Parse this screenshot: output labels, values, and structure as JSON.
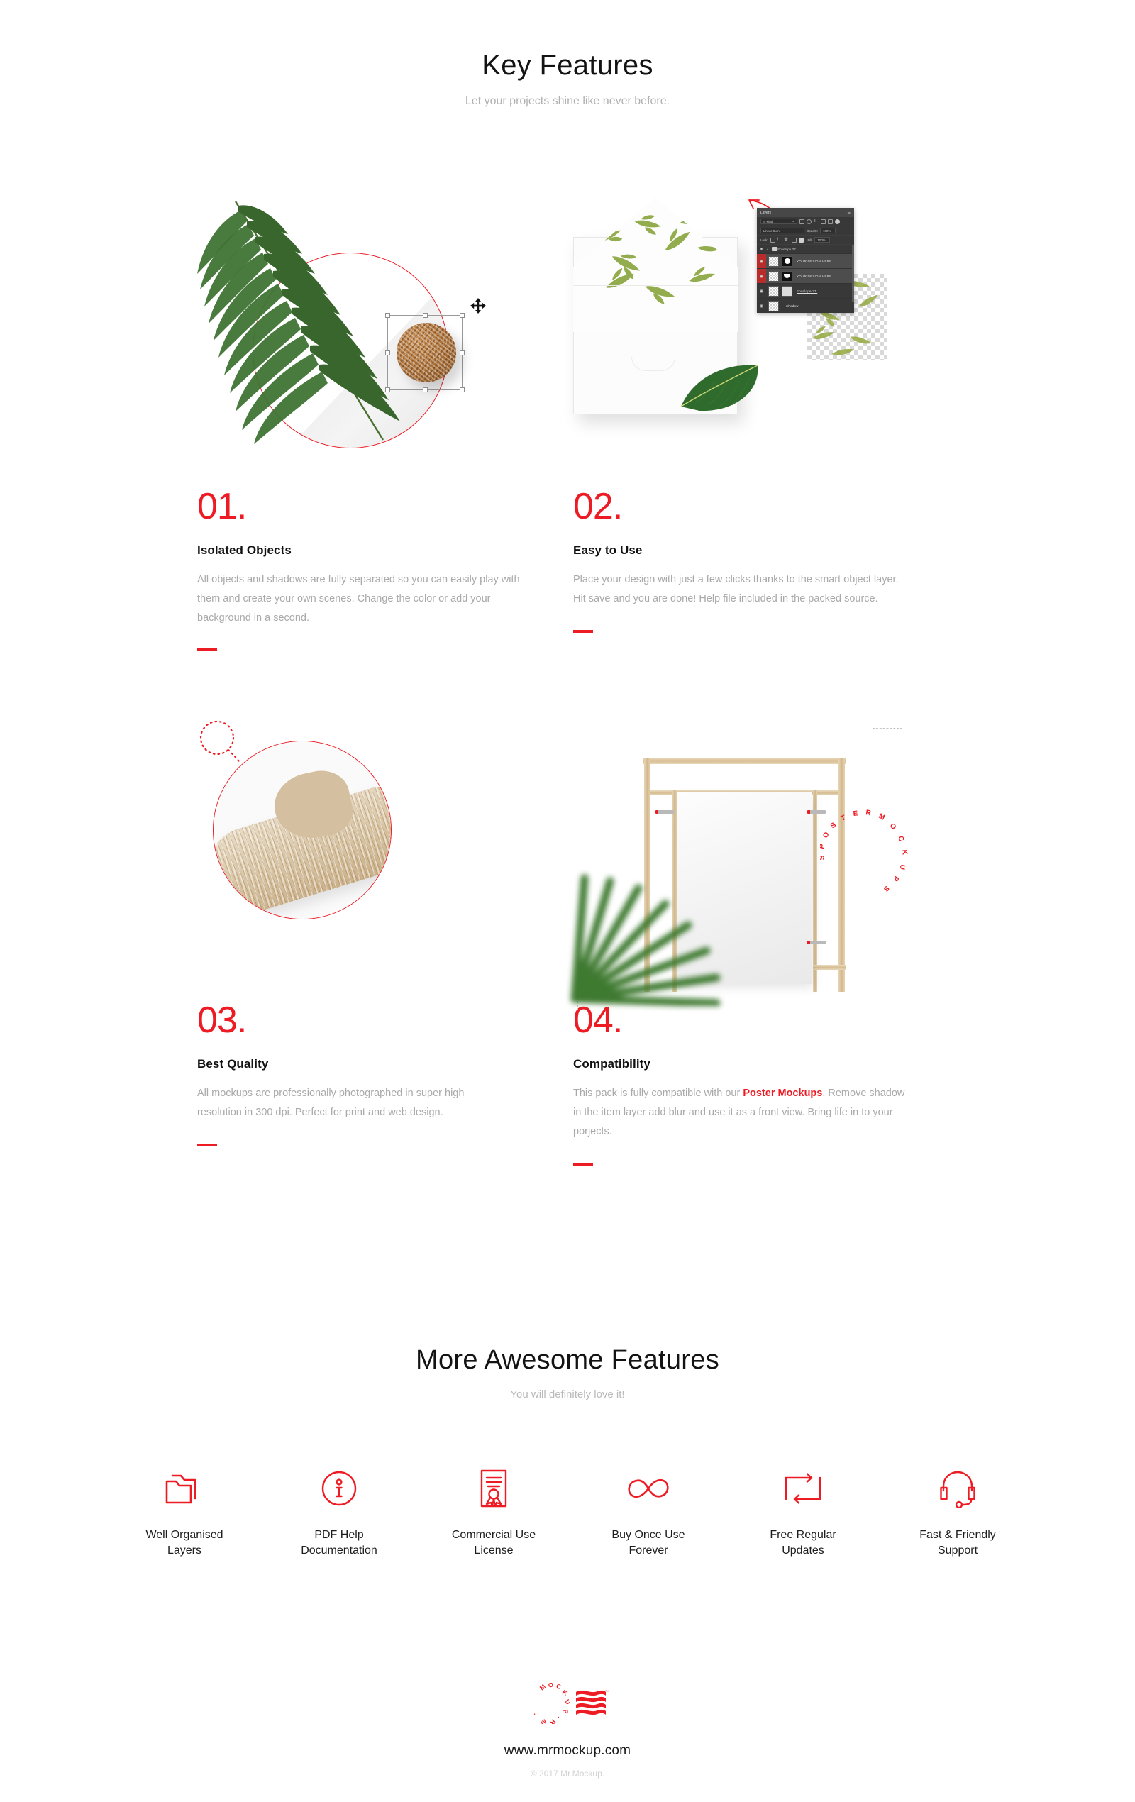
{
  "hero": {
    "title": "Key Features",
    "subtitle": "Let your projects shine like never before."
  },
  "features": [
    {
      "number": "01.",
      "title": "Isolated Objects",
      "desc": "All objects and shadows are fully separated so you can easily play with them and create your own scenes. Change the color or add your background in a second.",
      "desc_pre": "All objects and shadows are fully separated so you can easily play with them and create your own scenes. Change the color or add your background in a second.",
      "link": "",
      "desc_post": ""
    },
    {
      "number": "02.",
      "title": "Easy to Use",
      "desc": "Place your design with just a few clicks thanks to the smart object layer. Hit save and you are done! Help file included in the packed source.",
      "desc_pre": "Place your design with just a few clicks thanks to the smart object layer. Hit save and you are done! Help file included in the packed source.",
      "link": "",
      "desc_post": ""
    },
    {
      "number": "03.",
      "title": "Best Quality",
      "desc": "All mockups are professionally photographed in super high resolution in 300 dpi. Perfect for print and web design.",
      "desc_pre": "All mockups are professionally photographed in super high resolution in 300 dpi. Perfect for print and web design.",
      "link": "",
      "desc_post": ""
    },
    {
      "number": "04.",
      "title": "Compatibility",
      "desc": "This pack is fully compatible with our Poster Mockups. Remove shadow in the item layer add blur and use it as a front view. Bring life in to your porjects.",
      "desc_pre": "This pack is fully compatible with our ",
      "link": "Poster Mockups",
      "desc_post": ". Remove shadow in the item layer add blur and use it as a front view. Bring life in to your porjects."
    }
  ],
  "layers_panel": {
    "tab": "Layers",
    "kind_filter": "Kind",
    "blend_mode": "Linear Burn",
    "opacity_label": "Opacity:",
    "opacity_value": "100%",
    "lock_label": "Lock:",
    "fill_label": "Fill:",
    "fill_value": "100%",
    "group": "Envelope 27",
    "rows": [
      {
        "name": "YOUR DESIGN HERE",
        "selected": true,
        "mask": "circle"
      },
      {
        "name": "YOUR DESIGN HERE",
        "selected": true,
        "mask": "arch"
      },
      {
        "name": "Envelope 27.",
        "selected": false,
        "mask": "shape"
      },
      {
        "name": "Shadow",
        "selected": false,
        "mask": "none"
      }
    ]
  },
  "poster_ring_text": "POSTERMOCKUPS",
  "more": {
    "title": "More Awesome Features",
    "subtitle": "You will definitely love it!",
    "items": [
      {
        "icon": "folders-icon",
        "label_line1": "Well Organised",
        "label_line2": "Layers"
      },
      {
        "icon": "info-circle-icon",
        "label_line1": "PDF Help",
        "label_line2": "Documentation"
      },
      {
        "icon": "certificate-icon",
        "label_line1": "Commercial Use",
        "label_line2": "License"
      },
      {
        "icon": "infinity-icon",
        "label_line1": "Buy Once Use",
        "label_line2": "Forever"
      },
      {
        "icon": "refresh-loop-icon",
        "label_line1": "Free Regular",
        "label_line2": "Updates"
      },
      {
        "icon": "headset-icon",
        "label_line1": "Fast & Friendly",
        "label_line2": "Support"
      }
    ]
  },
  "footer": {
    "logo_ring_text": "MR. MOCKUP",
    "logo_tm": "™",
    "url": "www.mrmockup.com",
    "copyright": "© 2017 Mr.Mockup."
  },
  "colors": {
    "accent_red": "#ED1C24",
    "heading": "#131313",
    "muted": "#b1b1b1",
    "body_text": "#a9a9a9",
    "background": "#ffffff"
  }
}
